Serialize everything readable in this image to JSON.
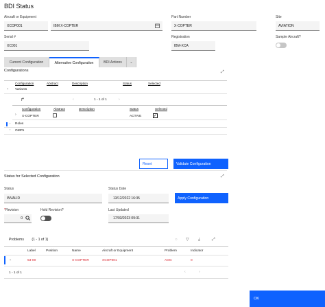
{
  "window": {
    "title": "BDI Status"
  },
  "fields": {
    "aircraft_label": "Aircraft or Equipment",
    "aircraft_value": "XCOP001",
    "aircraft_desc": "IBM X-COPTER",
    "part_label": "Part Number",
    "part_value": "X-COPTER",
    "site_label": "Site",
    "site_value": "AVIATION",
    "serial_label": "Serial #",
    "serial_value": "XC001",
    "registration_label": "Registration",
    "registration_value": "IBM-XCA",
    "sample_label": "Sample Aircraft?"
  },
  "tabs": [
    "Current Configuration",
    "Alternative Configuration",
    "BDI Actions"
  ],
  "configurations": {
    "title": "Configurations",
    "columns": [
      "Configuration",
      "Abstract",
      "Description",
      "Status",
      "Selected"
    ],
    "variants_label": "Variants",
    "pagination": "1 - 1 of 1",
    "inner_columns": [
      "Configuration",
      "Abstract",
      "Description",
      "Status",
      "Selected"
    ],
    "inner_row": {
      "configuration": "X-COPTER",
      "status": "ACTIVE"
    },
    "roles_label": "Roles",
    "omps_label": "OMPs",
    "reset_button": "Reset",
    "validate_button": "Validate Configuration"
  },
  "status_section": {
    "title": "Status for Selected Configuration",
    "status_label": "Status",
    "status_value": "INVALID",
    "status_date_label": "Status Date",
    "status_date_value": "13/12/2022 16:35",
    "apply_button": "Apply Configuration",
    "revision_required": "*",
    "revision_label": "Revision",
    "revision_value": "0",
    "hold_label": "Hold Revision?",
    "last_updated_label": "Last Updated",
    "last_updated_value": "17/03/2023 09:31"
  },
  "problems": {
    "title": "Problems",
    "count": "(1 - 1 of 1)",
    "columns": [
      "Label",
      "Position",
      "Name",
      "Aircraft or Equipment",
      "Problem",
      "Indicator"
    ],
    "row": {
      "label": "53-00",
      "position": "",
      "name": "X-COPTER",
      "aircraft": "XCOP001",
      "problem": "AOG",
      "indicator": "0"
    },
    "pagination": "1 - 1 of 1"
  },
  "footer": {
    "ok_button": "OK"
  },
  "colors": {
    "accent": "#0f62fe",
    "error": "#da1e28"
  }
}
